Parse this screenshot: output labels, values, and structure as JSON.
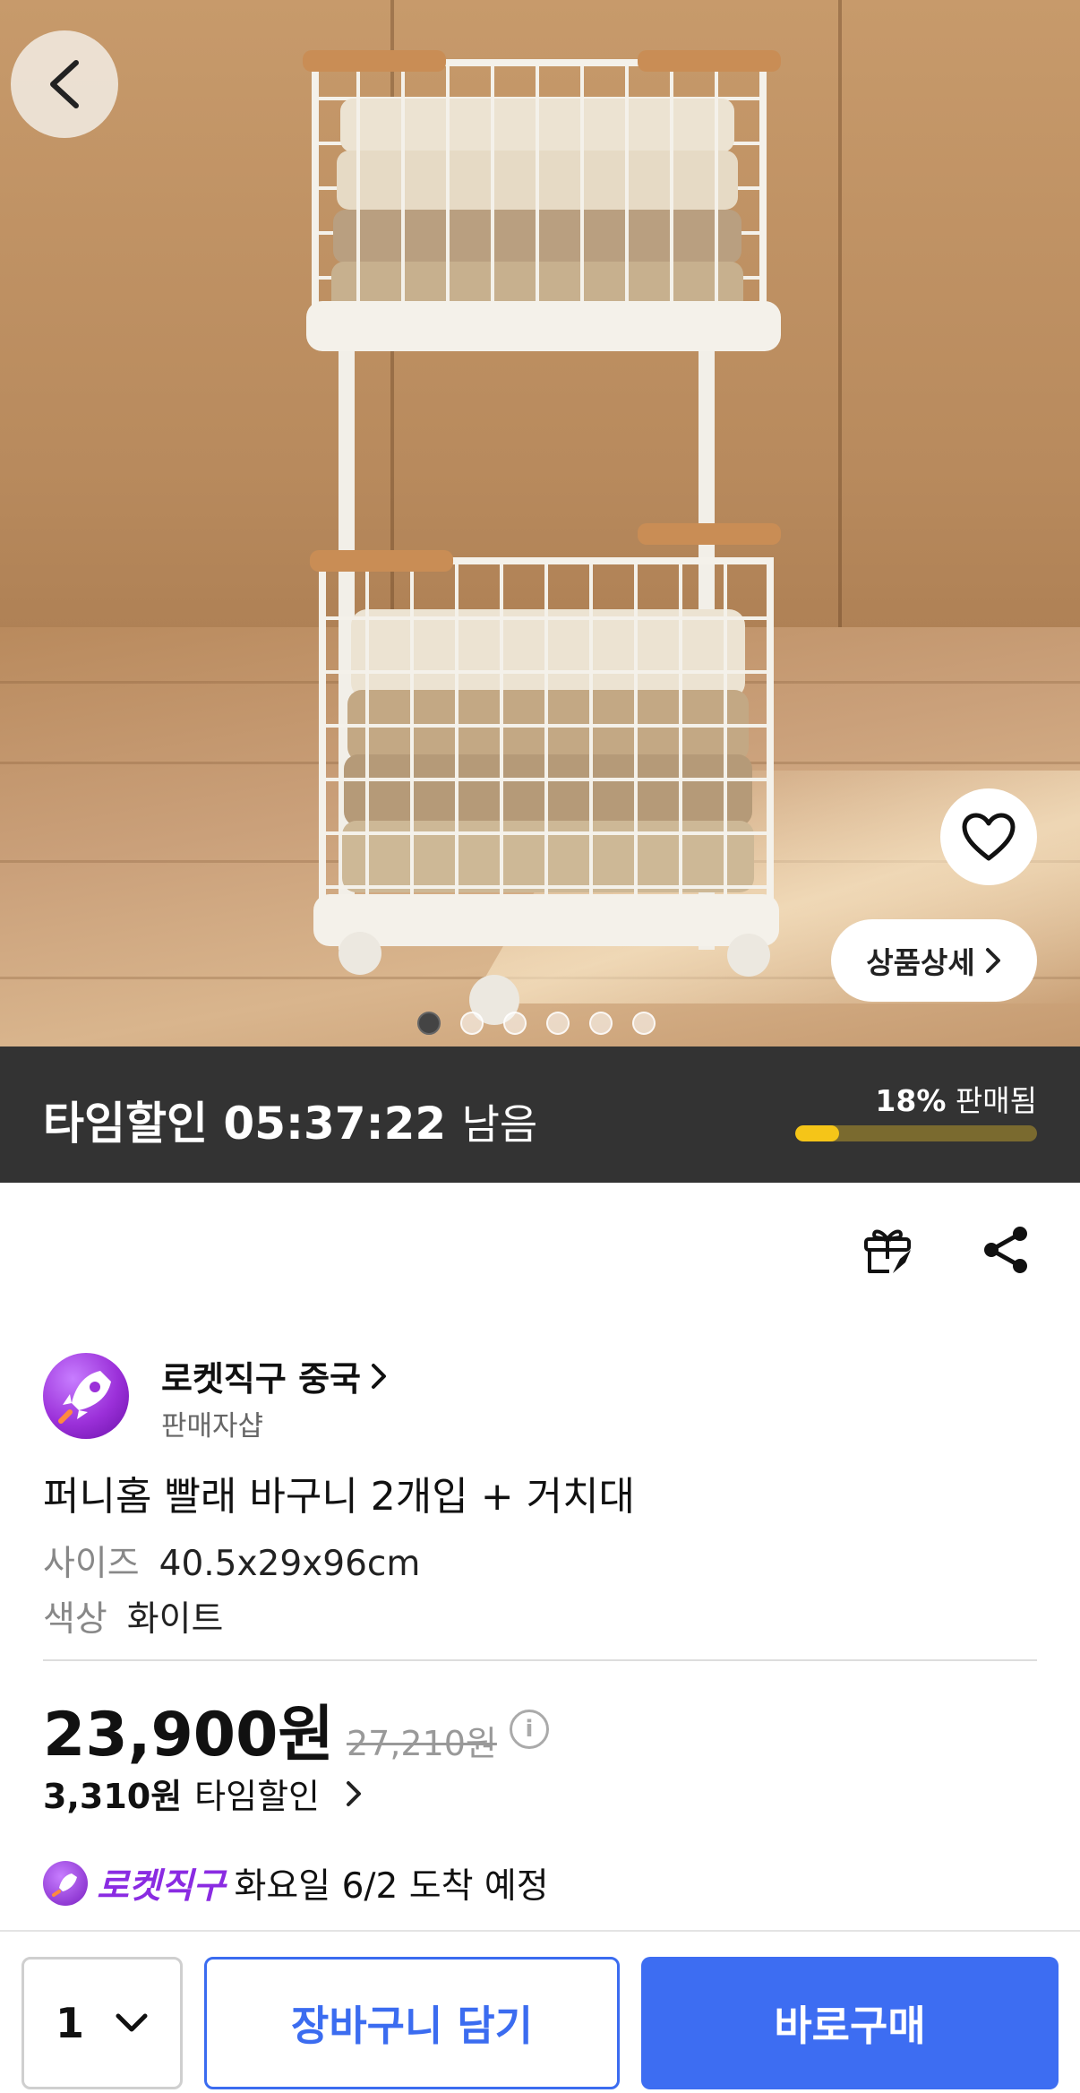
{
  "hero": {
    "icons": {
      "back": "chevron-left-icon",
      "heart": "heart-icon"
    },
    "detail_button": "상품상세",
    "image_count": 6,
    "active_image_index": 0
  },
  "timer": {
    "label": "타임할인",
    "time": "05:37:22",
    "suffix": "남음",
    "sold_percent": "18%",
    "sold_label": "판매됨",
    "sold_fraction": 0.18
  },
  "actions": {
    "gift_icon": "gift-icon",
    "share_icon": "share-icon"
  },
  "seller": {
    "name": "로켓직구 중국",
    "subtitle": "판매자샵"
  },
  "product": {
    "title": "퍼니홈 빨래 바구니 2개입 + 거치대",
    "options": [
      {
        "key": "사이즈",
        "value": "40.5x29x96cm"
      },
      {
        "key": "색상",
        "value": "화이트"
      }
    ]
  },
  "pricing": {
    "price": "23,900원",
    "original_price": "27,210원",
    "info_icon": "i",
    "discount_amount": "3,310원",
    "discount_label": "타임할인"
  },
  "delivery": {
    "badge": "로켓직구",
    "text": "화요일 6/2 도착 예정"
  },
  "bottom_bar": {
    "quantity": "1",
    "cart_button": "장바구니 담기",
    "buy_button": "바로구매"
  },
  "colors": {
    "accent_blue": "#3d6df2",
    "timer_bg": "#333333",
    "progress_fill": "#f5c518",
    "rocket_purple": "#8a2be2"
  }
}
